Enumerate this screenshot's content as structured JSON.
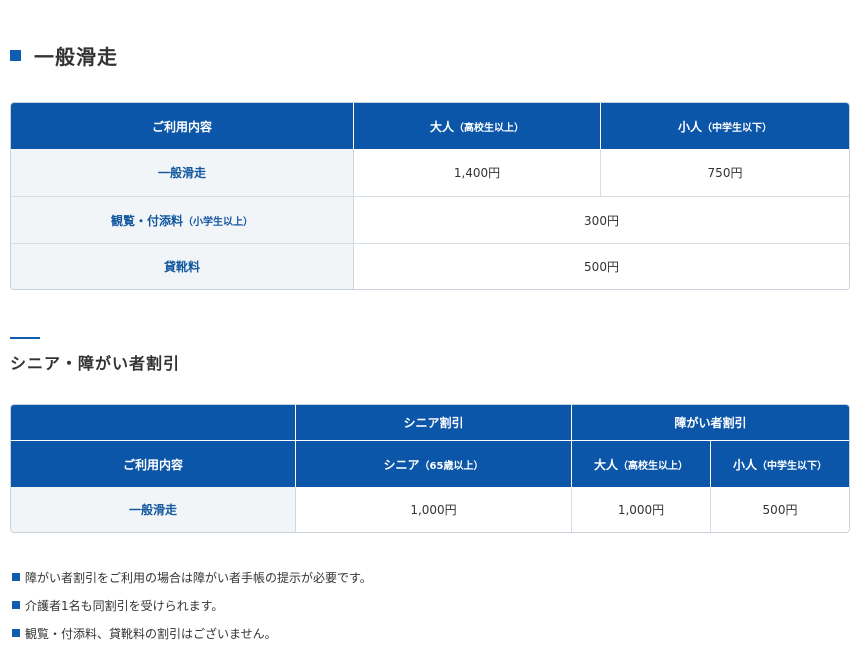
{
  "section1": {
    "title": "一般滑走",
    "table": {
      "header": {
        "col1": "ご利用内容",
        "col2_main": "大人",
        "col2_sub": "（高校生以上）",
        "col3_main": "小人",
        "col3_sub": "（中学生以下）"
      },
      "rows": [
        {
          "label": "一般滑走",
          "label_sub": "",
          "adult": "1,400円",
          "child": "750円"
        },
        {
          "label": "観覧・付添料",
          "label_sub": "（小学生以上）",
          "merged": "300円"
        },
        {
          "label": "貸靴料",
          "label_sub": "",
          "merged": "500円"
        }
      ]
    }
  },
  "section2": {
    "title": "シニア・障がい者割引",
    "table": {
      "header_top": {
        "senior_group": "シニア割引",
        "disabled_group": "障がい者割引"
      },
      "header_bottom": {
        "col1": "ご利用内容",
        "senior_main": "シニア",
        "senior_sub": "（65歳以上）",
        "adult_main": "大人",
        "adult_sub": "（高校生以上）",
        "child_main": "小人",
        "child_sub": "（中学生以下）"
      },
      "rows": [
        {
          "label": "一般滑走",
          "senior": "1,000円",
          "adult": "1,000円",
          "child": "500円"
        }
      ]
    }
  },
  "notes": [
    "障がい者割引をご利用の場合は障がい者手帳の提示が必要です。",
    "介護者1名も同割引を受けられます。",
    "観覧・付添料、貸靴料の割引はございません。"
  ],
  "colors": {
    "header_bg": "#0b56a8",
    "label_bg": "#f2f5f8",
    "label_text": "#13579e",
    "accent": "#0f5db1"
  }
}
